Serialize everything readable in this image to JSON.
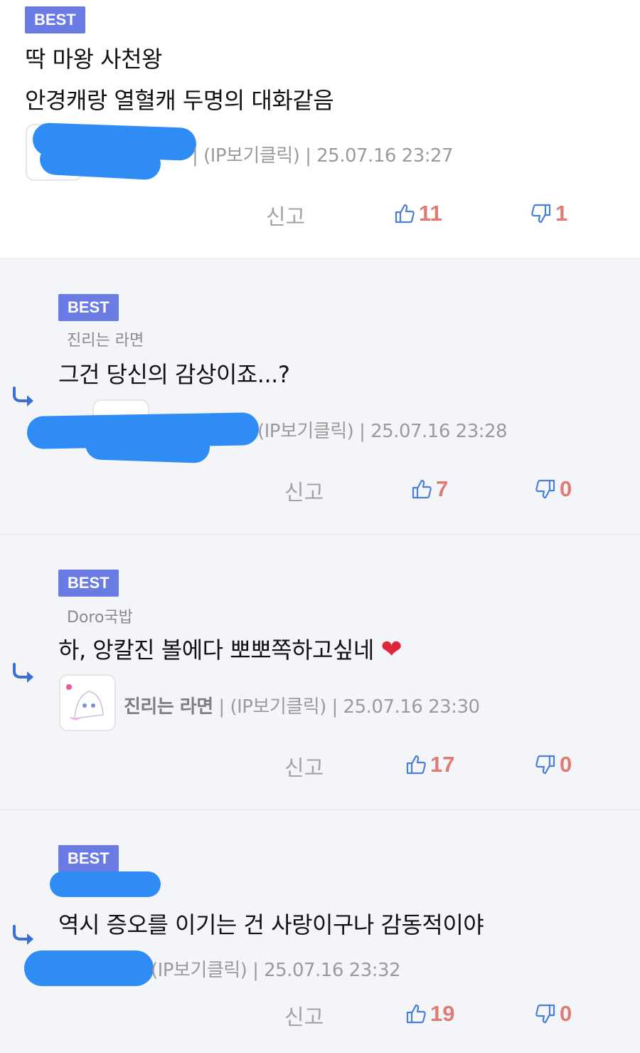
{
  "comments": [
    {
      "badge": "BEST",
      "lines": [
        "딱 마왕 사천왕",
        "안경캐랑 열혈캐 두명의 대화같음"
      ],
      "meta": "| (IP보기클릭) | 25.07.16 23:27",
      "report": "신고",
      "likes": "11",
      "dislikes": "1"
    },
    {
      "badge": "BEST",
      "reply_to": "진리는 라면",
      "lines": [
        "그건 당신의 감상이죠...?"
      ],
      "meta": "(IP보기클릭) | 25.07.16 23:28",
      "report": "신고",
      "likes": "7",
      "dislikes": "0"
    },
    {
      "badge": "BEST",
      "reply_to": "Doro국밥",
      "lines": [
        "하, 앙칼진 볼에다 뽀뽀쪽하고싶네"
      ],
      "nickname": "진리는 라면",
      "meta": "| (IP보기클릭) | 25.07.16 23:30",
      "report": "신고",
      "likes": "17",
      "dislikes": "0"
    },
    {
      "badge": "BEST",
      "lines": [
        "역시 증오를 이기는 건 사랑이구나 감동적이야"
      ],
      "meta": "(IP보기클릭) | 25.07.16 23:32",
      "report": "신고",
      "likes": "19",
      "dislikes": "0"
    }
  ],
  "icons": {
    "like": "thumbs-up-icon",
    "dislike": "thumbs-down-icon",
    "reply": "reply-arrow-icon",
    "heart": "heart-emoji"
  },
  "colors": {
    "badge": "#6b7be4",
    "vote": "#e07a75",
    "vote_icon": "#4a7fd8",
    "redaction": "#2f8cf4"
  }
}
